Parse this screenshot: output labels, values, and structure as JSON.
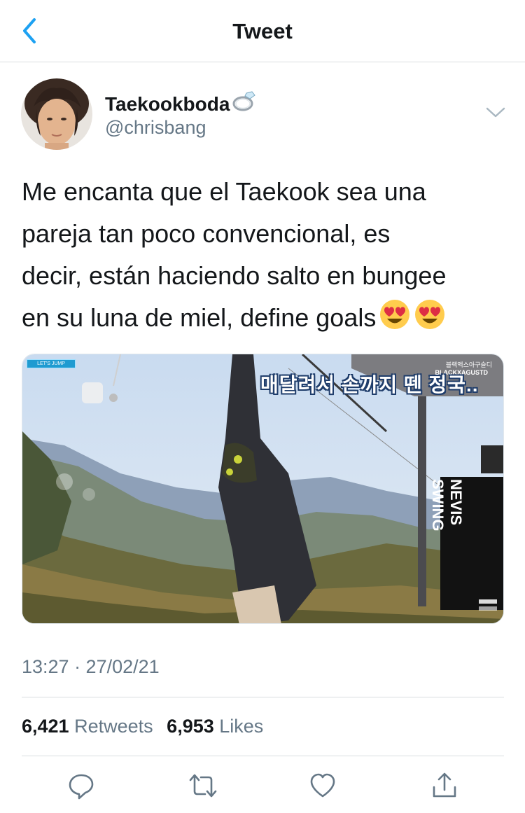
{
  "nav": {
    "title": "Tweet",
    "back_icon": "chevron-left-icon",
    "accent": "#1da1f2"
  },
  "author": {
    "display_name": "Taekookboda",
    "badge_icon": "ring-icon",
    "handle": "@chrisbang"
  },
  "tweet": {
    "text": "Me encanta que el Taekook sea una\npareja tan poco convencional, es\ndecir, están haciendo salto en bungee\nen su luna de miel, define goals",
    "emojis": [
      "heart-eyes-emoji",
      "heart-eyes-emoji"
    ]
  },
  "media": {
    "caption": "매달려서 손까지 뗀 정국..",
    "watermark_korean": "블랙액스아구슬디",
    "watermark_latin": "BLACKXAGUSTD",
    "sign_line1": "NEVIS",
    "sign_line2": "SWING",
    "tag": "LET'S JUMP"
  },
  "meta": {
    "timestamp": "13:27 · 27/02/21"
  },
  "stats": {
    "retweets_count": "6,421",
    "retweets_label": "Retweets",
    "likes_count": "6,953",
    "likes_label": "Likes"
  },
  "actions": [
    "reply-icon",
    "retweet-icon",
    "like-icon",
    "share-icon"
  ],
  "colors": {
    "text_primary": "#14171a",
    "text_secondary": "#657786",
    "divider": "#d9dde0"
  }
}
